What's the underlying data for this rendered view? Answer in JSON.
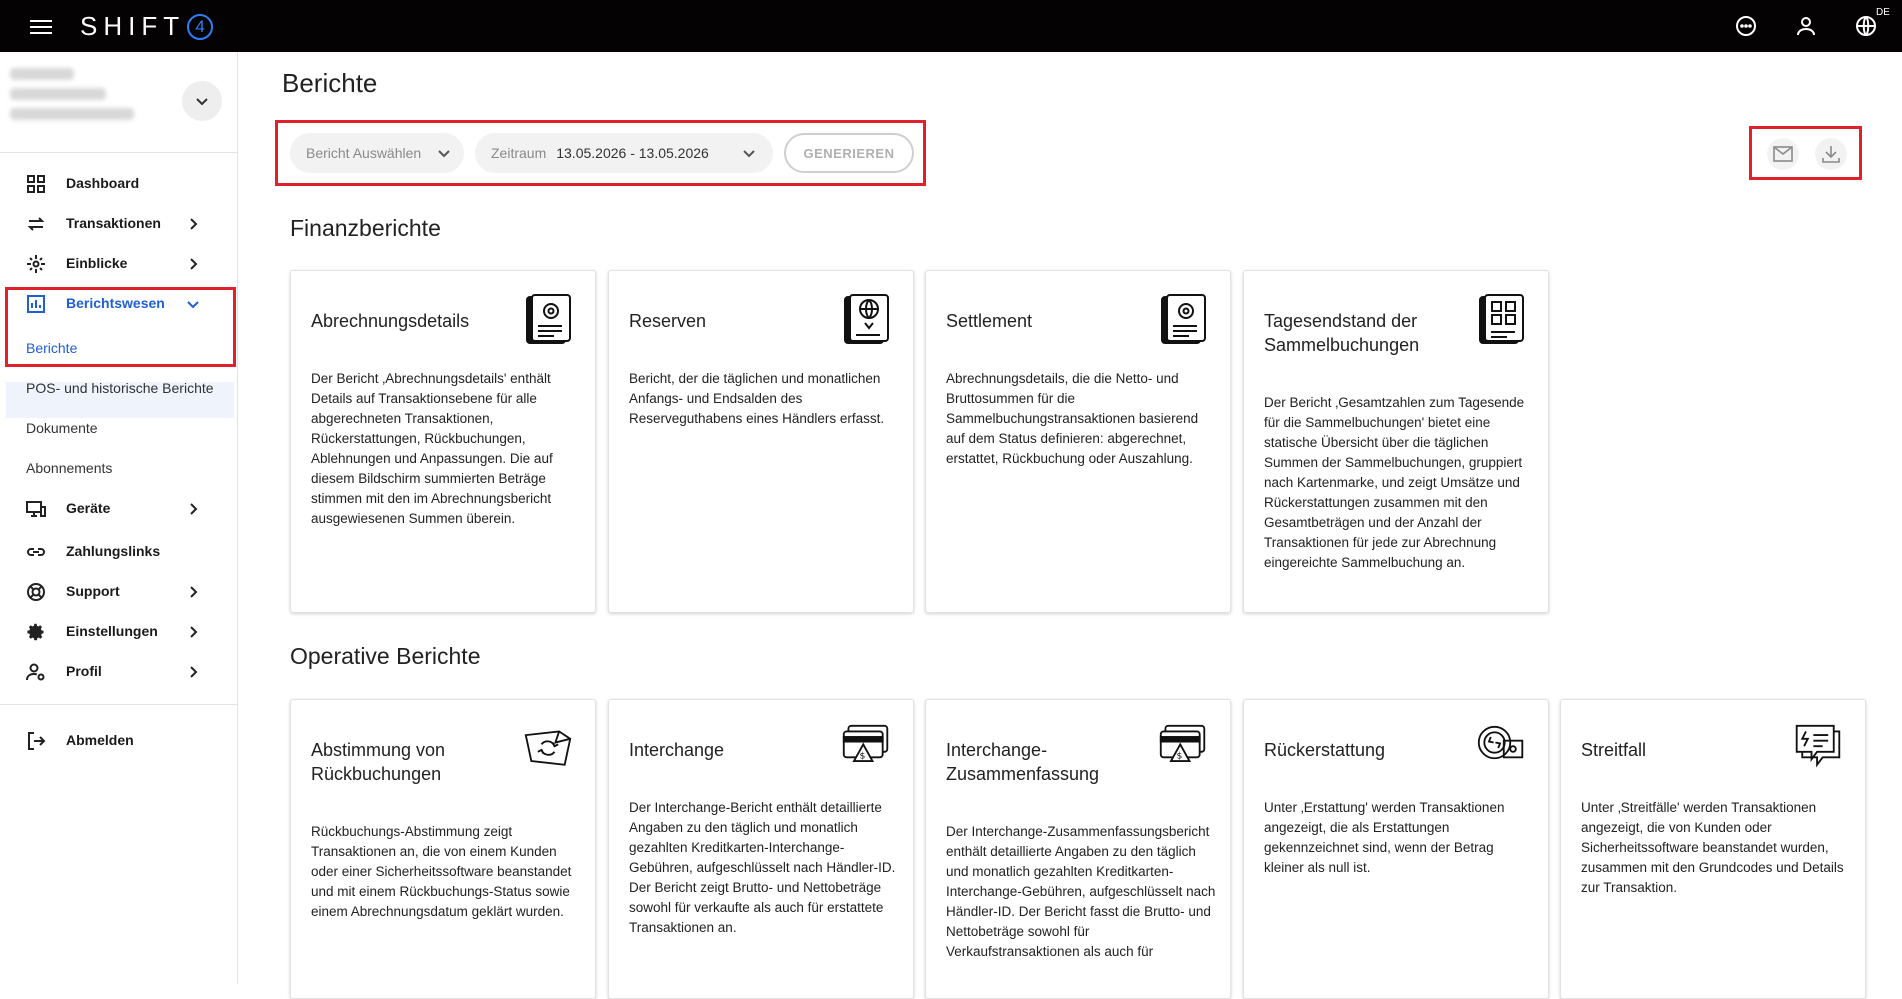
{
  "topbar": {
    "logo_text": "SHIFT",
    "logo_badge": "4",
    "lang": "DE",
    "icons": [
      "menu-icon",
      "chat-icon",
      "user-icon",
      "globe-icon"
    ]
  },
  "sidebar": {
    "nav": [
      {
        "label": "Dashboard",
        "icon": "dashboard-icon"
      },
      {
        "label": "Transaktionen",
        "icon": "arrows-icon"
      },
      {
        "label": "Einblicke",
        "icon": "insights-icon"
      },
      {
        "label": "Berichtswesen",
        "icon": "chart-icon"
      }
    ],
    "sub": [
      "Berichte",
      "POS- und historische Berichte",
      "Dokumente",
      "Abonnements"
    ],
    "nav2": [
      {
        "label": "Geräte",
        "icon": "devices-icon"
      },
      {
        "label": "Zahlungslinks",
        "icon": "link-icon"
      },
      {
        "label": "Support",
        "icon": "support-icon"
      },
      {
        "label": "Einstellungen",
        "icon": "gear-icon"
      },
      {
        "label": "Profil",
        "icon": "profile-settings-icon"
      }
    ],
    "logout": "Abmelden"
  },
  "main": {
    "title": "Berichte",
    "report_select": "Bericht Auswählen",
    "range_label": "Zeitraum",
    "range_value": "13.05.2026 - 13.05.2026",
    "generate": "GENERIEREN",
    "sections": [
      {
        "title": "Finanzberichte",
        "cards": [
          {
            "title": "Abrechnungsdetails",
            "icon": "settings-document-icon",
            "desc": "Der Bericht ‚Abrechnungsdetails' enthält Details auf Transaktionsebene für alle abgerechneten Transaktionen, Rückerstattungen, Rückbuchungen, Ablehnungen und Anpassungen. Die auf diesem Bildschirm summierten Beträge stimmen mit den im Abrechnungsbericht ausgewiesenen Summen überein."
          },
          {
            "title": "Reserven",
            "icon": "globe-dollar-document-icon",
            "desc": "Bericht, der die täglichen und monatlichen Anfangs- und Endsalden des Reserveguthabens eines Händlers erfasst."
          },
          {
            "title": "Settlement",
            "icon": "settings-document-icon",
            "desc": "Abrechnungsdetails, die die Netto- und Bruttosummen für die Sammelbuchungstransaktionen basierend auf dem Status definieren: abgerechnet, erstattet, Rückbuchung oder Auszahlung."
          },
          {
            "title": "Tagesendstand der Sammelbuchungen",
            "icon": "grid-document-icon",
            "desc": "Der Bericht ‚Gesamtzahlen zum Tagesende für die Sammelbuchungen' bietet eine statische Übersicht über die täglichen Summen der Sammelbuchungen, gruppiert nach Kartenmarke, und zeigt Umsätze und Rückerstattungen zusammen mit den Gesamtbeträgen und der Anzahl der Transaktionen für jede zur Abrechnung eingereichte Sammelbuchung an."
          }
        ]
      },
      {
        "title": "Operative Berichte",
        "cards": [
          {
            "title": "Abstimmung von Rückbuchungen",
            "icon": "refresh-flag-icon",
            "desc": "Rückbuchungs-Abstimmung zeigt Transaktionen an, die von einem Kunden oder einer Sicherheitssoftware beanstandet und mit einem Rückbuchungs-Status sowie einem Abrechnungsdatum geklärt wurden."
          },
          {
            "title": "Interchange",
            "icon": "cards-dollar-icon",
            "desc": "Der Interchange-Bericht enthält detaillierte Angaben zu den täglich und monatlich gezahlten Kreditkarten-Interchange-Gebühren, aufgeschlüsselt nach Händler-ID. Der Bericht zeigt Brutto- und Nettobeträge sowohl für verkaufte als auch für erstattete Transaktionen an."
          },
          {
            "title": "Interchange-Zusammenfassung",
            "icon": "cards-dollar-icon",
            "desc": "Der Interchange-Zusammenfassungsbericht enthält detaillierte Angaben zu den täglich und monatlich gezahlten Kreditkarten-Interchange-Gebühren, aufgeschlüsselt nach Händler-ID. Der Bericht fasst die Brutto- und Nettobeträge sowohl für Verkaufstransaktionen als auch für"
          },
          {
            "title": "Rückerstattung",
            "icon": "coin-refund-icon",
            "desc": "Unter ‚Erstattung' werden Transaktionen angezeigt, die als Erstattungen gekennzeichnet sind, wenn der Betrag kleiner als null ist."
          },
          {
            "title": "Streitfall",
            "icon": "dispute-chat-icon",
            "desc": "Unter ‚Streitfälle' werden Transaktionen angezeigt, die von Kunden oder Sicherheitssoftware beanstandet wurden, zusammen mit den Grundcodes und Details zur Transaktion."
          }
        ]
      }
    ]
  },
  "colors": {
    "accent": "#1f5fd6",
    "highlight": "#e0202a",
    "topbar": "#040203"
  }
}
